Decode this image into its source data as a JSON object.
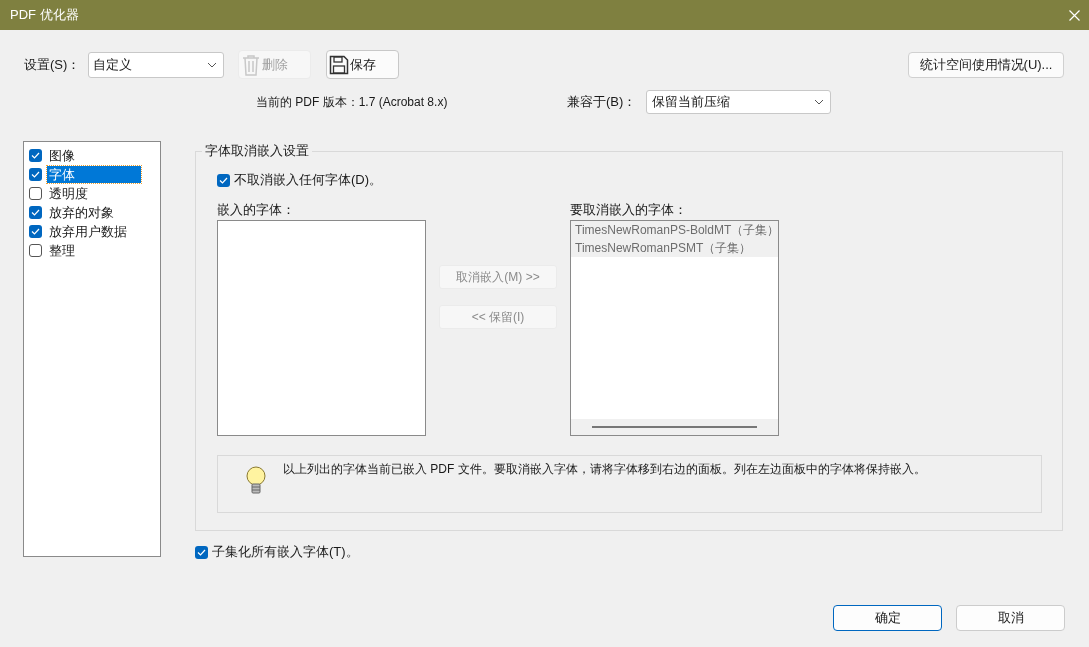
{
  "window": {
    "title": "PDF 优化器"
  },
  "settings": {
    "label": "设置(S)：",
    "value": "自定义"
  },
  "toolbar": [
    {
      "kind": "delete",
      "label": "删除",
      "disabled": true
    },
    {
      "kind": "save",
      "label": "保存",
      "disabled": false
    }
  ],
  "audit_button": "统计空间使用情况(U)...",
  "version_text": "当前的 PDF 版本：1.7 (Acrobat 8.x)",
  "compat": {
    "label": "兼容于(B)：",
    "value": "保留当前压缩"
  },
  "categories": [
    {
      "label": "图像",
      "checked": true,
      "selected": false
    },
    {
      "label": "字体",
      "checked": true,
      "selected": true
    },
    {
      "label": "透明度",
      "checked": false,
      "selected": false
    },
    {
      "label": "放弃的对象",
      "checked": true,
      "selected": false
    },
    {
      "label": "放弃用户数据",
      "checked": true,
      "selected": false
    },
    {
      "label": "整理",
      "checked": false,
      "selected": false
    }
  ],
  "font_group": {
    "title": "字体取消嵌入设置",
    "no_unembed": {
      "label": "不取消嵌入任何字体(D)。",
      "checked": true
    },
    "embedded_label": "嵌入的字体：",
    "unembed_label": "要取消嵌入的字体：",
    "move_buttons": [
      {
        "label": "取消嵌入(M) >>",
        "disabled": true
      },
      {
        "label": "<< 保留(I)",
        "disabled": true
      }
    ],
    "unembed_list": {
      "disabled": true,
      "items": [
        "TimesNewRomanPS-BoldMT（子集）",
        "TimesNewRomanPSMT（子集）"
      ]
    },
    "info": "以上列出的字体当前已嵌入 PDF 文件。要取消嵌入字体，请将字体移到右边的面板。列在左边面板中的字体将保持嵌入。"
  },
  "subset": {
    "label": "子集化所有嵌入字体(T)。",
    "checked": true
  },
  "buttons": [
    {
      "label": "确定",
      "default": true
    },
    {
      "label": "取消",
      "default": false
    }
  ]
}
